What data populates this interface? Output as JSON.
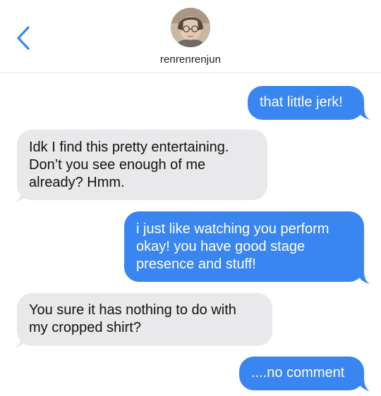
{
  "header": {
    "contact_name": "renrenrenjun",
    "back_icon": "chevron-left-icon"
  },
  "colors": {
    "outgoing_bubble": "#3a86f0",
    "incoming_bubble": "#e9e9eb",
    "accent": "#3a86f0"
  },
  "messages": [
    {
      "direction": "outgoing",
      "text": "that little jerk!"
    },
    {
      "direction": "incoming",
      "text": "Idk I find this pretty entertaining.\nDon’t you see enough of me\nalready? Hmm."
    },
    {
      "direction": "outgoing",
      "text": "i just like watching you perform\nokay! you have good stage\npresence and stuff!"
    },
    {
      "direction": "incoming",
      "text": "You sure it has nothing to do with\nmy cropped shirt?"
    },
    {
      "direction": "outgoing",
      "text": "....no comment"
    }
  ]
}
